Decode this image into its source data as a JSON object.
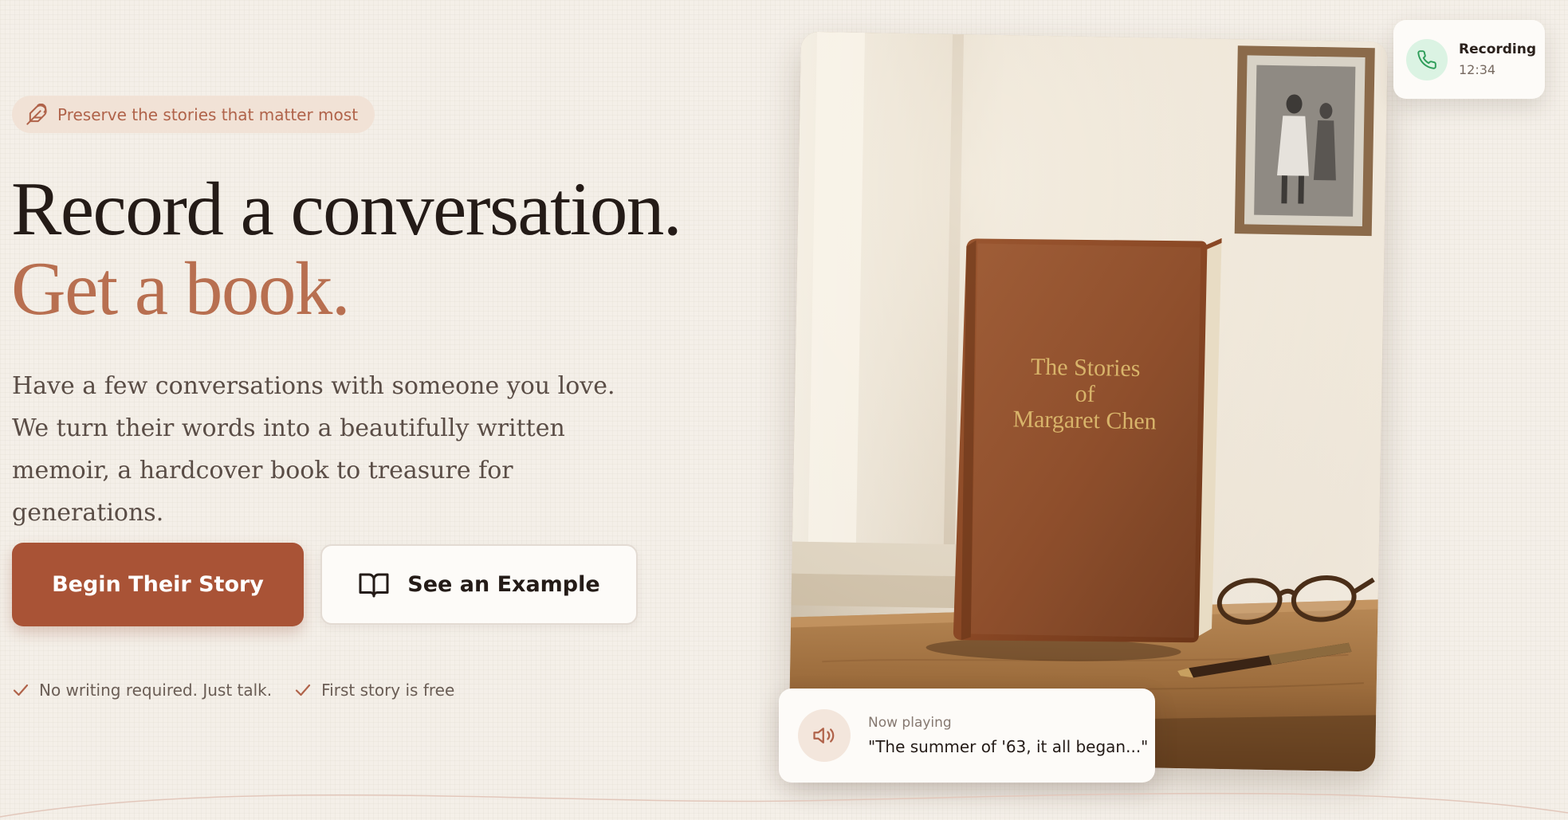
{
  "badge": {
    "icon": "feather-icon",
    "text": "Preserve the stories that matter most"
  },
  "headline": {
    "line1": "Record a conversation.",
    "line2": "Get a book."
  },
  "description": "Have a few conversations with someone you love. We turn their words into a beautifully written memoir, a hardcover book to treasure for generations.",
  "buttons": {
    "primary": "Begin Their Story",
    "secondary": "See an Example",
    "secondary_icon": "open-book-icon"
  },
  "features": [
    "No writing required. Just talk.",
    "First story is free"
  ],
  "hero_image": {
    "book_title_line1": "The Stories",
    "book_title_line2": "of",
    "book_title_line3": "Margaret Chen"
  },
  "recording_card": {
    "icon": "phone-icon",
    "label": "Recording",
    "time": "12:34"
  },
  "now_playing_card": {
    "icon": "speaker-icon",
    "label": "Now playing",
    "quote": "\"The summer of '63, it all began...\""
  },
  "colors": {
    "background": "#f4efe8",
    "accent": "#a95336",
    "accent_text": "#b86f50",
    "badge_bg": "#f1e2d6",
    "recording_icon_bg": "#dbf3e3",
    "recording_icon": "#2f9e5a"
  }
}
